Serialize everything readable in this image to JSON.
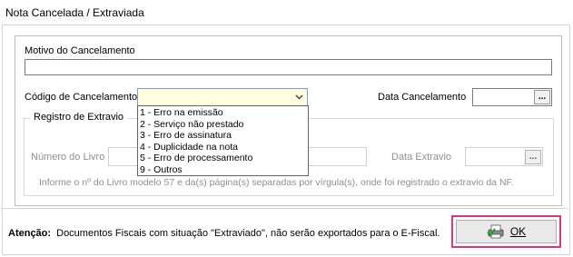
{
  "window": {
    "title": "Nota Cancelada / Extraviada"
  },
  "motivo": {
    "label": "Motivo do Cancelamento",
    "value": ""
  },
  "codigo": {
    "label": "Código de Cancelamento",
    "value": "",
    "options": [
      "1 - Erro na emissão",
      "2 - Serviço não prestado",
      "3 - Erro de assinatura",
      "4 - Duplicidade na nota",
      "5 - Erro de processamento",
      "9 - Outros"
    ]
  },
  "data_cancelamento": {
    "label": "Data Cancelamento",
    "value": "",
    "button": "..."
  },
  "registro": {
    "title": "Registro de Extravio",
    "numero_label": "Número do Livro",
    "data_extravio_label": "Data Extravio",
    "button": "...",
    "hint": "Informe o nº do Livro modelo 57 e da(s) página(s) separadas por vírgula(s), onde foi registrado o extravio da NF."
  },
  "atencao": {
    "label": "Atenção:",
    "text": "Documentos Fiscais com situação \"Extraviado\", não serão exportados para o E-Fiscal."
  },
  "ok_button": {
    "label": "OK",
    "icon": "printer-check-icon"
  },
  "colors": {
    "highlight": "#e0357a",
    "combo_bg": "#ffffe0"
  }
}
